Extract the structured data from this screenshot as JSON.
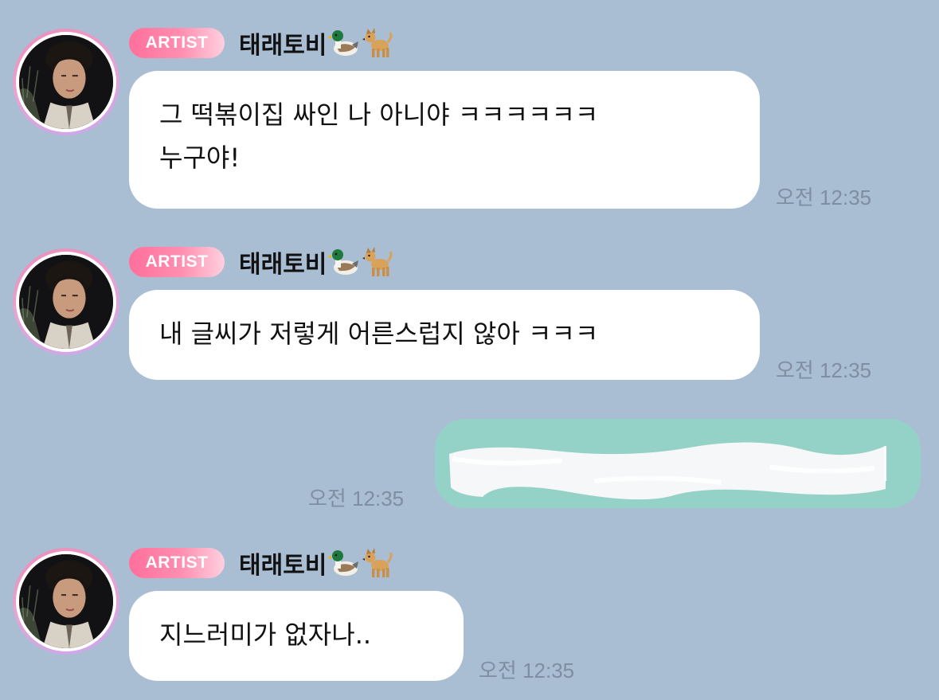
{
  "chat": {
    "messages": [
      {
        "sender": "태래토비",
        "badge": "ARTIST",
        "lines": [
          "그 떡볶이집 싸인 나 아니야 ㅋㅋㅋㅋㅋㅋ",
          "누구야!"
        ],
        "time": "오전 12:35"
      },
      {
        "sender": "태래토비",
        "badge": "ARTIST",
        "lines": [
          "내 글씨가 저렇게 어른스럽지 않아 ㅋㅋㅋ"
        ],
        "time": "오전 12:35"
      },
      {
        "sender": "me",
        "redacted": true,
        "time": "오전 12:35"
      },
      {
        "sender": "태래토비",
        "badge": "ARTIST",
        "lines": [
          "지느러미가 없자나.."
        ],
        "time": "오전 12:35"
      }
    ],
    "icons": {
      "sender_emoji_1": "duck-icon",
      "sender_emoji_2": "dog-icon"
    },
    "colors": {
      "background": "#a9bdd3",
      "incoming_bubble": "#ffffff",
      "outgoing_bubble": "#94d2c8",
      "badge_start": "#ff6f9c",
      "badge_end": "#ffd0df",
      "time_text": "#7f8ea0"
    }
  }
}
